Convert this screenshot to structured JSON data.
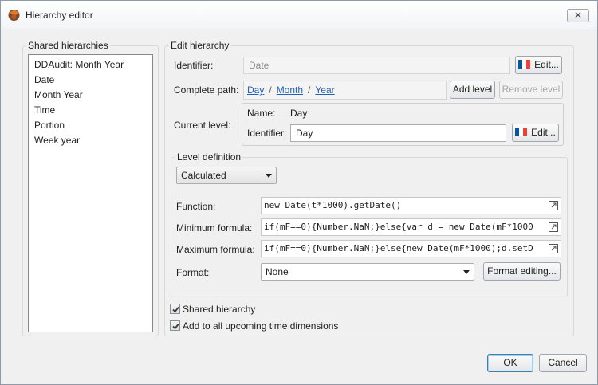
{
  "window": {
    "title": "Hierarchy editor",
    "close_label": "✕"
  },
  "shared": {
    "label": "Shared hierarchies",
    "items": [
      "DDAudit: Month Year",
      "Date",
      "Month Year",
      "Time",
      "Portion",
      "Week year"
    ]
  },
  "edit": {
    "label": "Edit hierarchy",
    "identifier_label": "Identifier:",
    "identifier_value": "Date",
    "edit_label": "Edit...",
    "path_label": "Complete path:",
    "path": [
      "Day",
      "Month",
      "Year"
    ],
    "path_sep": "/",
    "add_level": "Add level",
    "remove_level": "Remove level",
    "current_level_label": "Current level:",
    "name_label": "Name:",
    "name_value": "Day",
    "level_identifier_label": "Identifier:",
    "level_identifier_value": "Day"
  },
  "level_def": {
    "label": "Level definition",
    "type_selected": "Calculated",
    "function_label": "Function:",
    "function_value": "new Date(t*1000).getDate()",
    "min_label": "Minimum formula:",
    "min_value": "if(mF==0){Number.NaN;}else{var d = new Date(mF*1000",
    "max_label": "Maximum formula:",
    "max_value": "if(mF==0){Number.NaN;}else{new Date(mF*1000);d.setD",
    "format_label": "Format:",
    "format_selected": "None",
    "format_edit": "Format editing..."
  },
  "options": {
    "shared_hierarchy": "Shared hierarchy",
    "shared_checked": true,
    "add_all": "Add to all upcoming time dimensions",
    "add_all_checked": true
  },
  "footer": {
    "ok": "OK",
    "cancel": "Cancel"
  },
  "colors": {
    "link": "#2260b4",
    "accent": "#3c7fb1"
  }
}
